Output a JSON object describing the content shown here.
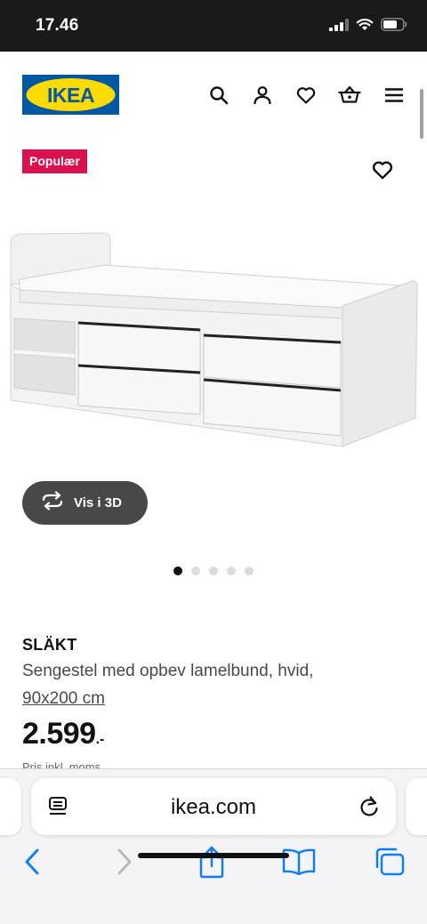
{
  "status_bar": {
    "time": "17.46"
  },
  "header": {
    "logo_text": "IKEA",
    "icons": [
      "search-icon",
      "user-icon",
      "heart-icon",
      "basket-icon",
      "menu-icon"
    ]
  },
  "badge": {
    "label": "Populær"
  },
  "view_3d": {
    "label": "Vis i 3D"
  },
  "carousel": {
    "total": 5,
    "active": 1
  },
  "product": {
    "name": "SLÄKT",
    "description": "Sengestel med opbev lamelbund, hvid,",
    "size": "90x200 cm",
    "price": "2.599",
    "price_suffix": ".-",
    "price_note": "Pris inkl. moms"
  },
  "browser": {
    "url": "ikea.com"
  },
  "colors": {
    "ikea_blue": "#0058a3",
    "ikea_yellow": "#ffdb00",
    "badge_red": "#d9124f",
    "ios_blue": "#0a7bff"
  }
}
